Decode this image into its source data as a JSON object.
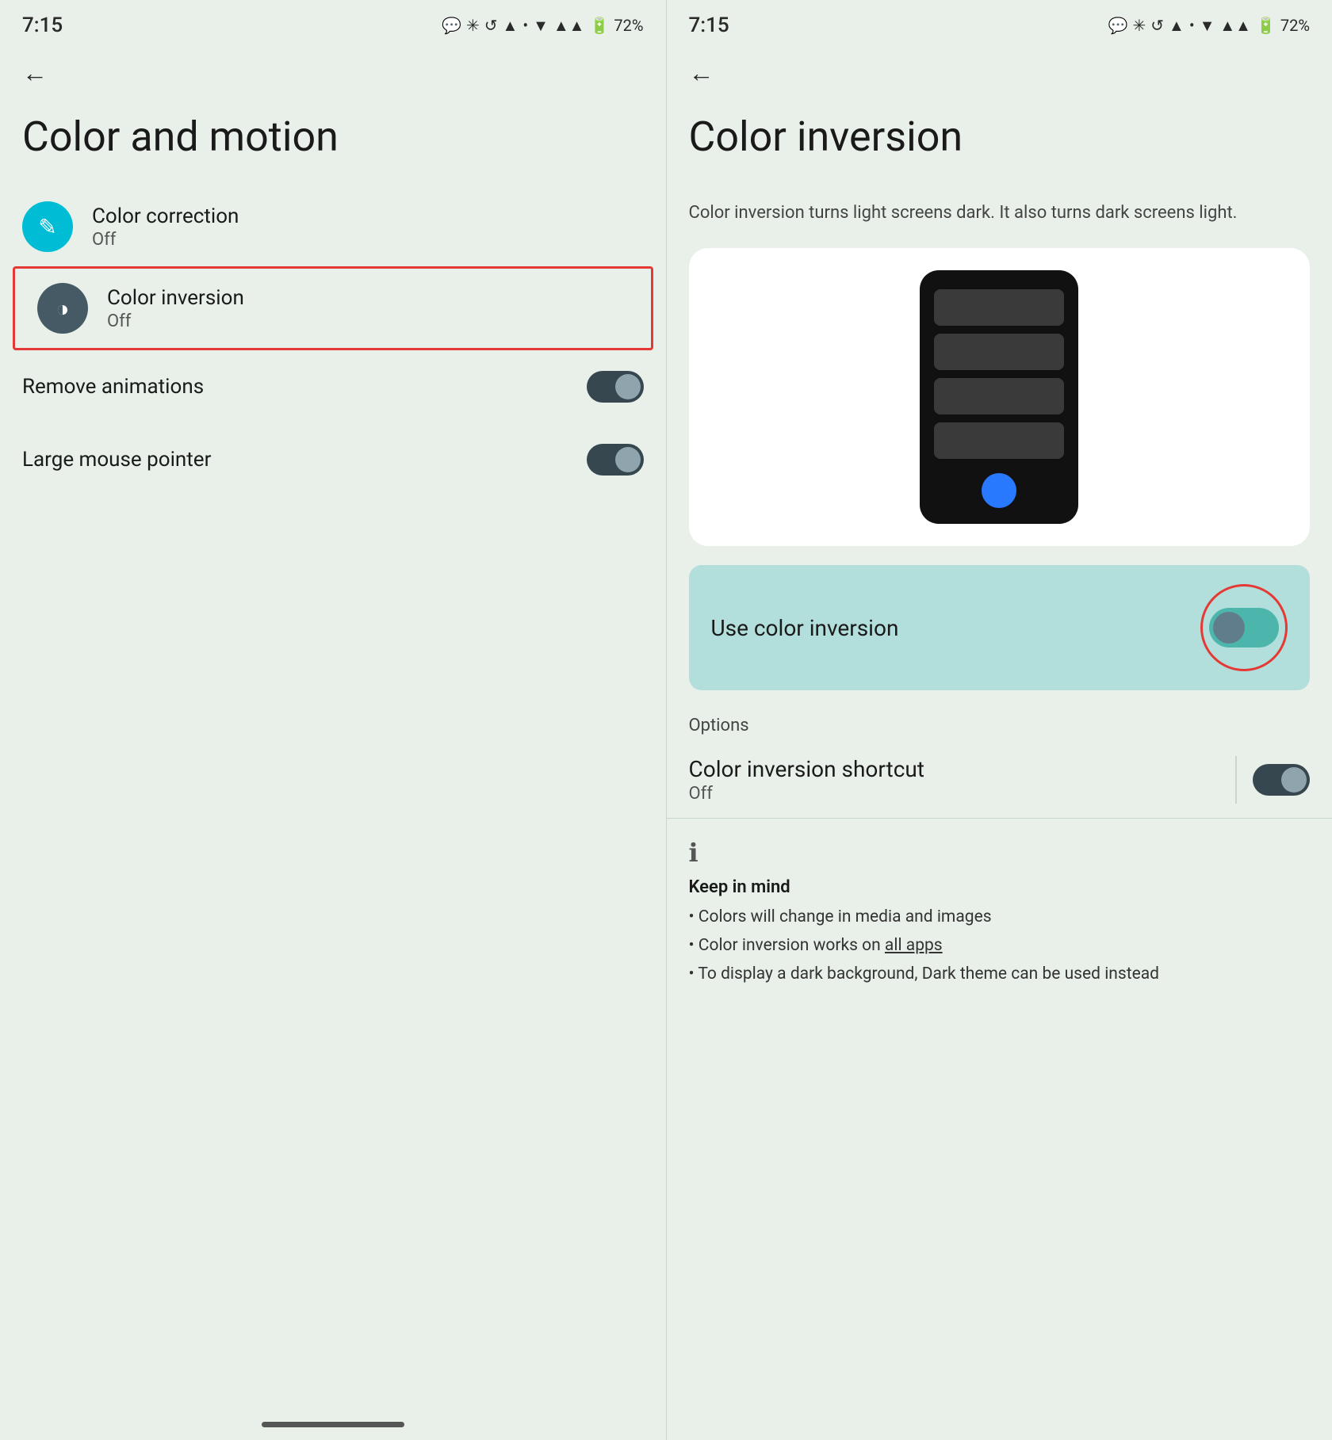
{
  "left_panel": {
    "status": {
      "time": "7:15",
      "battery": "72%"
    },
    "title": "Color and motion",
    "items": [
      {
        "id": "color-correction",
        "title": "Color correction",
        "subtitle": "Off",
        "icon": "✏️",
        "icon_type": "cyan",
        "highlighted": false
      },
      {
        "id": "color-inversion",
        "title": "Color inversion",
        "subtitle": "Off",
        "icon": "◑",
        "icon_type": "dark",
        "highlighted": true
      }
    ],
    "toggles": [
      {
        "id": "remove-animations",
        "label": "Remove animations",
        "on": true
      },
      {
        "id": "large-mouse-pointer",
        "label": "Large mouse pointer",
        "on": true
      }
    ],
    "bottom_bar": ""
  },
  "right_panel": {
    "status": {
      "time": "7:15",
      "battery": "72%"
    },
    "title": "Color inversion",
    "description": "Color inversion turns light screens dark. It also turns dark screens light.",
    "use_color_inversion_label": "Use color inversion",
    "options_label": "Options",
    "shortcut": {
      "title": "Color inversion shortcut",
      "subtitle": "Off"
    },
    "info": {
      "keep_in_mind_title": "Keep in mind",
      "items": [
        "• Colors will change in media and images",
        "• Color inversion works on all apps",
        "• To display a dark background, Dark theme can be used instead"
      ]
    }
  }
}
